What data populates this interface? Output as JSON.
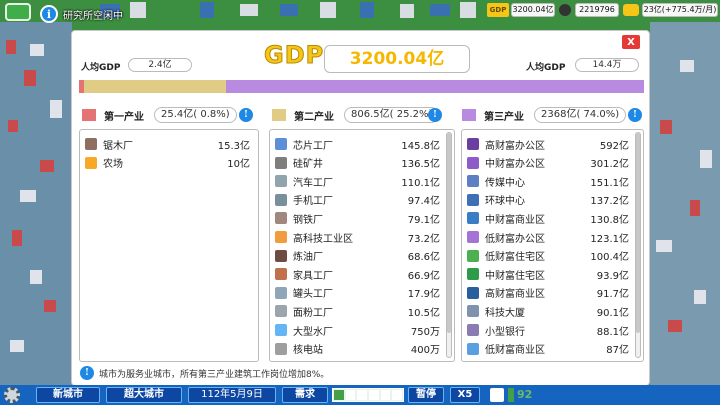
{
  "topbar": {
    "research_label": "研究所空闲中",
    "gdp_badge": "GDP",
    "gdp_value": "3200.04亿",
    "population": "2219796",
    "income": "23亿(+775.4万/月)"
  },
  "dialog": {
    "title": "GDP",
    "value": "3200.04亿",
    "close_label": "X",
    "per_capita_left_label": "人均GDP",
    "per_capita_left_value": "2.4亿",
    "per_capita_right_label": "人均GDP",
    "per_capita_right_value": "14.4万",
    "share_bar": [
      0.8,
      25.2,
      74.0
    ],
    "sectors": [
      {
        "name": "第一产业",
        "value": "25.4亿( 0.8%)",
        "color": "#e57373",
        "items": [
          {
            "label": "锯木厂",
            "value": "15.3亿",
            "icon_color": "#8d6e63"
          },
          {
            "label": "农场",
            "value": "10亿",
            "icon_color": "#f9a825"
          }
        ]
      },
      {
        "name": "第二产业",
        "value": "806.5亿( 25.2%)",
        "color": "#e0cc85",
        "items": [
          {
            "label": "芯片工厂",
            "value": "145.8亿",
            "icon_color": "#5c8fd6"
          },
          {
            "label": "硅矿井",
            "value": "136.5亿",
            "icon_color": "#7e7e7e"
          },
          {
            "label": "汽车工厂",
            "value": "110.1亿",
            "icon_color": "#90a4ae"
          },
          {
            "label": "手机工厂",
            "value": "97.4亿",
            "icon_color": "#78909c"
          },
          {
            "label": "钢铁厂",
            "value": "79.1亿",
            "icon_color": "#a1887f"
          },
          {
            "label": "高科技工业区",
            "value": "73.2亿",
            "icon_color": "#f39c3d"
          },
          {
            "label": "炼油厂",
            "value": "68.6亿",
            "icon_color": "#6d4c41"
          },
          {
            "label": "家具工厂",
            "value": "66.9亿",
            "icon_color": "#c0704a"
          },
          {
            "label": "罐头工厂",
            "value": "17.9亿",
            "icon_color": "#8fa6b8"
          },
          {
            "label": "面粉工厂",
            "value": "10.5亿",
            "icon_color": "#9aa5ad"
          },
          {
            "label": "大型水厂",
            "value": "750万",
            "icon_color": "#64b5f6"
          },
          {
            "label": "核电站",
            "value": "400万",
            "icon_color": "#9e9e9e"
          }
        ]
      },
      {
        "name": "第三产业",
        "value": "2368亿( 74.0%)",
        "color": "#b88be0",
        "items": [
          {
            "label": "高财富办公区",
            "value": "592亿",
            "icon_color": "#6a3fa0"
          },
          {
            "label": "中财富办公区",
            "value": "301.2亿",
            "icon_color": "#8e5cc9"
          },
          {
            "label": "传媒中心",
            "value": "151.1亿",
            "icon_color": "#5e7fc4"
          },
          {
            "label": "环球中心",
            "value": "137.2亿",
            "icon_color": "#3f6fb5"
          },
          {
            "label": "中财富商业区",
            "value": "130.8亿",
            "icon_color": "#3b7dc4"
          },
          {
            "label": "低财富办公区",
            "value": "123.1亿",
            "icon_color": "#a374d6"
          },
          {
            "label": "低财富住宅区",
            "value": "100.4亿",
            "icon_color": "#4caf50"
          },
          {
            "label": "中财富住宅区",
            "value": "93.9亿",
            "icon_color": "#2e9a4a"
          },
          {
            "label": "高财富商业区",
            "value": "91.7亿",
            "icon_color": "#2a5f9e"
          },
          {
            "label": "科技大厦",
            "value": "90.1亿",
            "icon_color": "#7f93b0"
          },
          {
            "label": "小型银行",
            "value": "88.1亿",
            "icon_color": "#8a7bb0"
          },
          {
            "label": "低财富商业区",
            "value": "87亿",
            "icon_color": "#5aa0e0"
          }
        ]
      }
    ],
    "footer_note": "城市为服务业城市，所有第三产业建筑工作岗位增加8%。"
  },
  "bottombar": {
    "new_city": "新城市",
    "mega_city": "超大城市",
    "date": "112年5月9日",
    "demand": "需求",
    "pause": "暂停",
    "speed": "X5",
    "rating": "92"
  },
  "colors": {
    "accent_blue": "#1565c0",
    "gdp_gold": "#f5c518",
    "close_red": "#e53935"
  }
}
